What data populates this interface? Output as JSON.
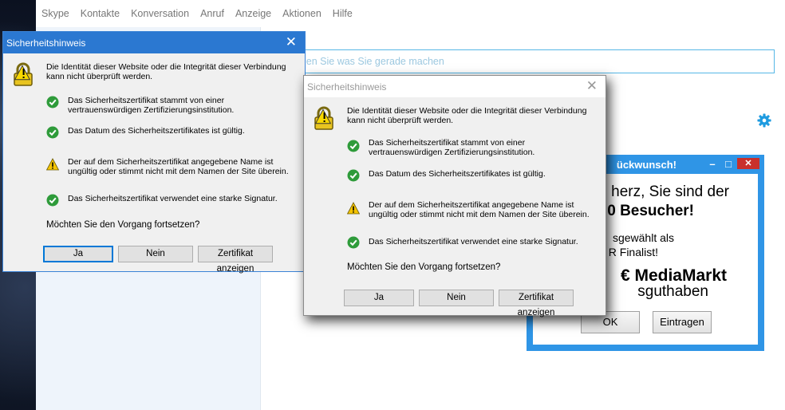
{
  "skype": {
    "menu": [
      "Skype",
      "Kontakte",
      "Konversation",
      "Anruf",
      "Anzeige",
      "Aktionen",
      "Hilfe"
    ],
    "status_placeholder": "len Sie was Sie gerade machen"
  },
  "dialog": {
    "title": "Sicherheitshinweis",
    "intro_line1": "Die Identität dieser Website oder die Integrität dieser Verbindung",
    "intro_line2": "kann nicht überprüft werden.",
    "check1_line1": "Das Sicherheitszertifikat stammt von einer",
    "check1_line2": "vertrauenswürdigen Zertifizierungsinstitution.",
    "check2": "Das Datum des Sicherheitszertifikates ist gültig.",
    "warn_line1": "Der auf dem Sicherheitszertifikat angegebene Name ist",
    "warn_line2": "ungültig oder stimmt nicht mit dem Namen der Site überein.",
    "check3": "Das Sicherheitszertifikat verwendet eine starke Signatur.",
    "question": "Möchten Sie den Vorgang fortsetzen?",
    "btn_ja": "Ja",
    "btn_nein": "Nein",
    "btn_cert": "Zertifikat anzeigen"
  },
  "ad": {
    "title": "ückwunsch!",
    "line1": "herz, Sie sind der",
    "line2": "0 Besucher!",
    "line3": "sgewählt als",
    "line4": "R Finalist!",
    "line5": "€ MediaMarkt",
    "line6": "sguthaben",
    "btn_ok": "OK",
    "btn_eintragen": "Eintragen"
  },
  "colors": {
    "dialog_active_title": "#2b78d1",
    "ad_frame": "#2f95e6",
    "check_green": "#2e9b3a",
    "warn_yellow": "#f5c400"
  }
}
